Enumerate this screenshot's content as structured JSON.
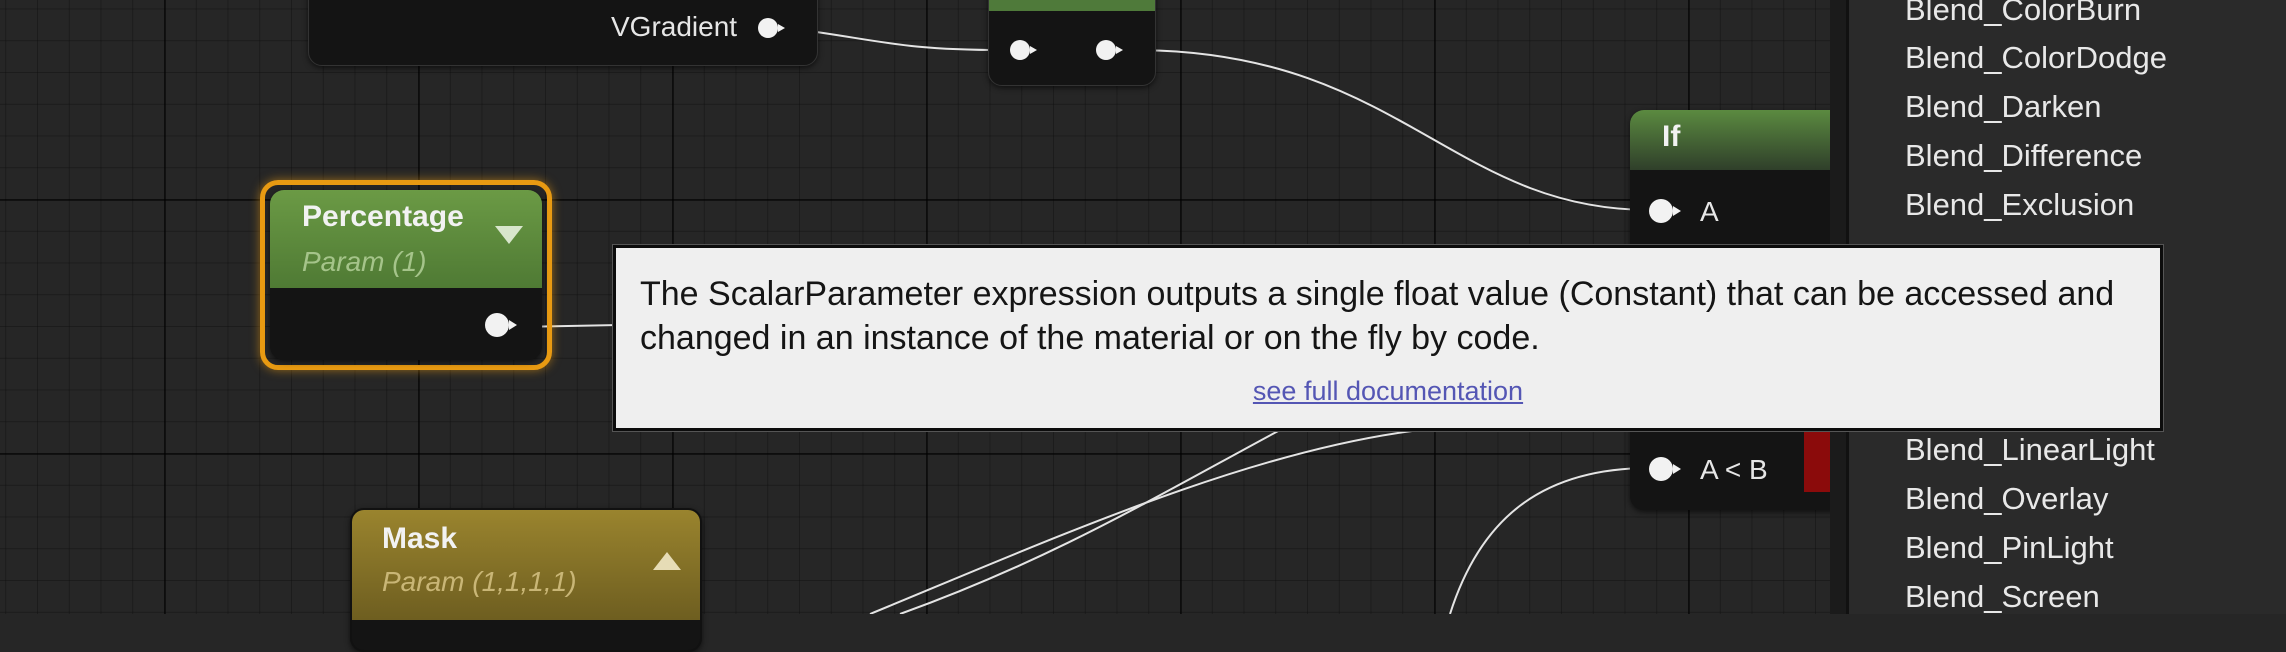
{
  "nodes": {
    "vgradient_node": {
      "pin_label": "VGradient"
    },
    "percentage_node": {
      "title": "Percentage",
      "subtitle": "Param (1)"
    },
    "mask_node": {
      "title": "Mask",
      "subtitle": "Param (1,1,1,1)"
    },
    "if_node": {
      "title": "If",
      "pin_a": "A",
      "pin_a_lt_b": "A < B"
    }
  },
  "menu": {
    "items": [
      "Blend_ColorBurn",
      "Blend_ColorDodge",
      "Blend_Darken",
      "Blend_Difference",
      "Blend_Exclusion",
      "Blend_LinearLight",
      "Blend_Overlay",
      "Blend_PinLight",
      "Blend_Screen"
    ]
  },
  "tooltip": {
    "text": "The ScalarParameter expression outputs a single float value (Constant) that can be accessed and changed in an instance of the material or on the fly by code.",
    "link": "see full documentation"
  },
  "colors": {
    "graph_background": "#262626",
    "param_header_green": "#5e8a3e",
    "mask_header_gold": "#8f7a2a",
    "selection_orange": "#e89a12",
    "link_blue": "#5456b4",
    "pin_red": "#8b0b0b"
  }
}
